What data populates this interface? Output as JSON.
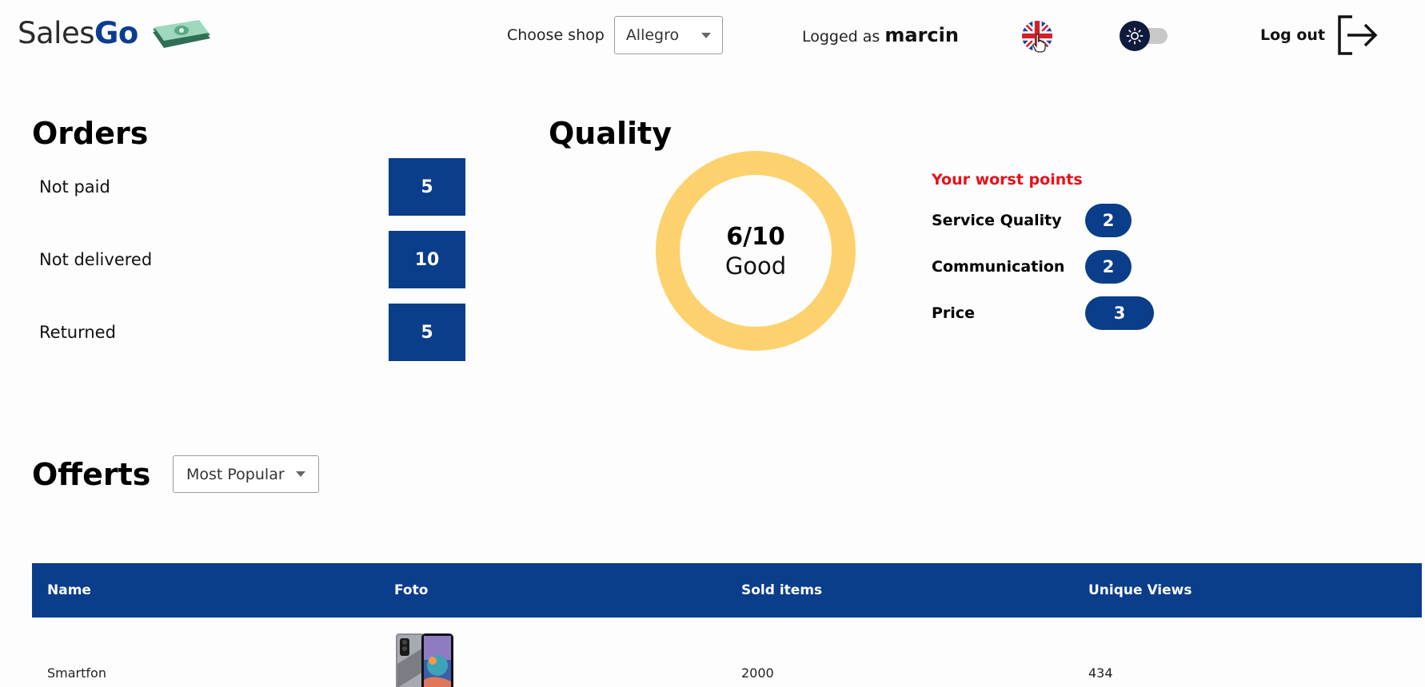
{
  "brand": {
    "name_part1": "Sales",
    "name_part2": "Go"
  },
  "header": {
    "choose_shop_label": "Choose shop",
    "shop_selected": "Allegro",
    "logged_prefix": "Logged as",
    "username": "marcin",
    "language_icon": "uk-flag-icon",
    "theme_icon": "sun-icon",
    "logout_label": "Log out"
  },
  "orders": {
    "title": "Orders",
    "items": [
      {
        "label": "Not paid",
        "count": "5"
      },
      {
        "label": "Not delivered",
        "count": "10"
      },
      {
        "label": "Returned",
        "count": "5"
      }
    ]
  },
  "quality": {
    "title": "Quality",
    "score": "6/10",
    "rating": "Good",
    "ring_color": "#fdd26e",
    "worst_title": "Your worst points",
    "worst_points": [
      {
        "label": "Service Quality",
        "value": "2"
      },
      {
        "label": "Communication",
        "value": "2"
      },
      {
        "label": "Price",
        "value": "3"
      }
    ]
  },
  "offerts": {
    "title": "Offerts",
    "sort_selected": "Most Popular",
    "columns": [
      "Name",
      "Foto",
      "Sold items",
      "Unique Views"
    ],
    "rows": [
      {
        "name": "Smartfon",
        "photo_icon": "smartphone-photo",
        "sold": "2000",
        "views": "434"
      }
    ]
  },
  "colors": {
    "primary": "#0a3d8a",
    "accent_red": "#e8101a",
    "ring": "#fdd26e"
  }
}
